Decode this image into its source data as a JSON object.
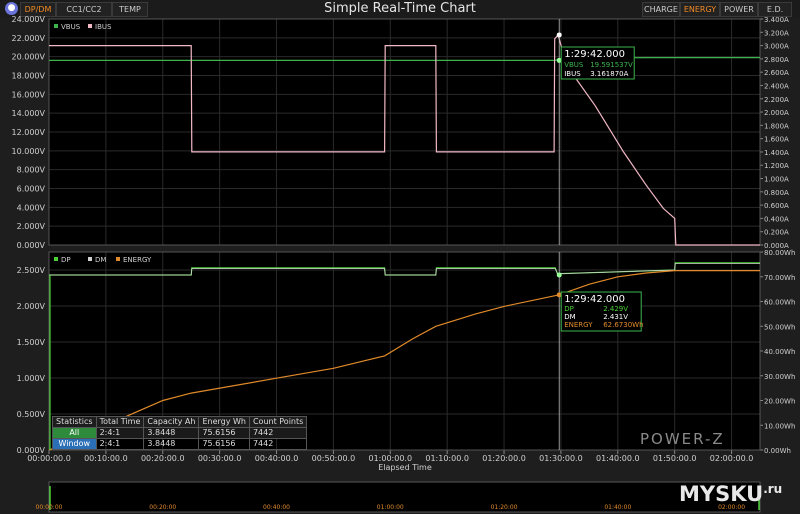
{
  "app": {
    "title": "Simple Real-Time Chart"
  },
  "left_tabs": [
    {
      "label": "DP/DM",
      "active": true
    },
    {
      "label": "CC1/CC2",
      "active": false
    },
    {
      "label": "TEMP",
      "active": false
    }
  ],
  "right_tabs": [
    {
      "label": "CHARGE",
      "active": false
    },
    {
      "label": "ENERGY",
      "active": true
    },
    {
      "label": "POWER",
      "active": false
    },
    {
      "label": "E.D.",
      "active": false
    }
  ],
  "colors": {
    "vbus": "#3cb44b",
    "ibus": "#f2b8c6",
    "dp": "#4cd137",
    "dm": "#d0d0d0",
    "energy": "#e08a2a",
    "accent": "#f08a24",
    "background": "#1e1e1e"
  },
  "chart_data": [
    {
      "type": "line",
      "legend": [
        "VBUS",
        "IBUS"
      ],
      "legend_position": "top-left",
      "x_ticks": [
        "00:00:00.0",
        "00:10:00.0",
        "00:20:00.0",
        "00:30:00.0",
        "00:40:00.0",
        "00:50:00.0",
        "01:00:00.0",
        "01:10:00.0",
        "01:20:00.0",
        "01:30:00.0",
        "01:40:00.0",
        "01:50:00.0",
        "02:00:00.0"
      ],
      "y_left_ticks": [
        "0.000V",
        "2.000V",
        "4.000V",
        "6.000V",
        "8.000V",
        "10.000V",
        "12.000V",
        "14.000V",
        "16.000V",
        "18.000V",
        "20.000V",
        "22.000V",
        "24.000V"
      ],
      "y_right_ticks": [
        "0.000A",
        "0.200A",
        "0.400A",
        "0.600A",
        "0.800A",
        "1.000A",
        "1.200A",
        "1.400A",
        "1.600A",
        "1.800A",
        "2.000A",
        "2.200A",
        "2.400A",
        "2.600A",
        "2.800A",
        "3.000A",
        "3.200A",
        "3.400A"
      ],
      "y_left_range": [
        0,
        24
      ],
      "y_right_range": [
        0,
        3.4
      ],
      "x_range_min": [
        0,
        125
      ],
      "series": [
        {
          "name": "VBUS",
          "axis": "left",
          "points": [
            [
              0,
              19.6
            ],
            [
              25,
              19.6
            ],
            [
              25.1,
              19.6
            ],
            [
              59,
              19.6
            ],
            [
              59.1,
              19.6
            ],
            [
              68,
              19.6
            ],
            [
              68.1,
              19.6
            ],
            [
              89,
              19.6
            ],
            [
              90,
              19.8
            ],
            [
              105,
              19.9
            ],
            [
              125,
              19.9
            ]
          ]
        },
        {
          "name": "IBUS",
          "axis": "right",
          "points": [
            [
              0,
              3.0
            ],
            [
              25,
              3.0
            ],
            [
              25.1,
              1.4
            ],
            [
              59,
              1.4
            ],
            [
              59.1,
              3.0
            ],
            [
              68,
              3.0
            ],
            [
              68.1,
              1.4
            ],
            [
              88.8,
              1.4
            ],
            [
              88.9,
              3.1
            ],
            [
              89.5,
              3.16
            ],
            [
              91,
              2.7
            ],
            [
              96,
              2.1
            ],
            [
              101,
              1.4
            ],
            [
              105,
              0.9
            ],
            [
              108,
              0.55
            ],
            [
              110,
              0.4
            ],
            [
              110.2,
              0.0
            ],
            [
              125,
              0.0
            ]
          ]
        }
      ],
      "cursor": {
        "time": "1:29:42.000",
        "x": 89.7,
        "readouts": [
          {
            "label": "VBUS",
            "value": "19.591537V"
          },
          {
            "label": "IBUS",
            "value": "3.161870A"
          }
        ]
      }
    },
    {
      "type": "line",
      "legend": [
        "DP",
        "DM",
        "ENERGY"
      ],
      "legend_position": "top-left",
      "x_ticks": [
        "00:00:00.0",
        "00:10:00.0",
        "00:20:00.0",
        "00:30:00.0",
        "00:40:00.0",
        "00:50:00.0",
        "01:00:00.0",
        "01:10:00.0",
        "01:20:00.0",
        "01:30:00.0",
        "01:40:00.0",
        "01:50:00.0",
        "02:00:00.0"
      ],
      "y_left_ticks": [
        "0.000V",
        "0.500V",
        "1.000V",
        "1.500V",
        "2.000V",
        "2.500V"
      ],
      "y_right_ticks": [
        "0.00Wh",
        "10.00Wh",
        "20.00Wh",
        "30.00Wh",
        "40.00Wh",
        "50.00Wh",
        "60.00Wh",
        "70.00Wh",
        "80.00Wh"
      ],
      "y_left_range": [
        0,
        2.75
      ],
      "y_right_range": [
        0,
        80
      ],
      "xlabel": "Elapsed Time",
      "series": [
        {
          "name": "DP",
          "axis": "left",
          "points": [
            [
              0,
              2.43
            ],
            [
              25,
              2.43
            ],
            [
              25.1,
              2.53
            ],
            [
              59,
              2.53
            ],
            [
              59.1,
              2.43
            ],
            [
              68,
              2.43
            ],
            [
              68.1,
              2.53
            ],
            [
              89,
              2.53
            ],
            [
              89.5,
              2.43
            ],
            [
              90,
              2.45
            ],
            [
              110,
              2.5
            ],
            [
              110.1,
              2.6
            ],
            [
              125,
              2.6
            ]
          ]
        },
        {
          "name": "DM",
          "axis": "left",
          "points": [
            [
              0,
              2.43
            ],
            [
              25,
              2.43
            ],
            [
              25.1,
              2.52
            ],
            [
              59,
              2.52
            ],
            [
              59.1,
              2.43
            ],
            [
              68,
              2.43
            ],
            [
              68.1,
              2.52
            ],
            [
              89,
              2.52
            ],
            [
              89.5,
              2.43
            ],
            [
              90,
              2.45
            ],
            [
              110,
              2.5
            ],
            [
              110.1,
              2.59
            ],
            [
              125,
              2.59
            ]
          ]
        },
        {
          "name": "ENERGY",
          "axis": "right",
          "points": [
            [
              0,
              0
            ],
            [
              5,
              4
            ],
            [
              12,
              12
            ],
            [
              20,
              20
            ],
            [
              25,
              23
            ],
            [
              40,
              29
            ],
            [
              50,
              33
            ],
            [
              59,
              38
            ],
            [
              64,
              45
            ],
            [
              68,
              50
            ],
            [
              75,
              55
            ],
            [
              80,
              58
            ],
            [
              89.7,
              62.7
            ],
            [
              95,
              67
            ],
            [
              100,
              70
            ],
            [
              105,
              71.5
            ],
            [
              110,
              72.5
            ],
            [
              125,
              72.5
            ]
          ]
        }
      ],
      "cursor": {
        "time": "1:29:42.000",
        "x": 89.7,
        "readouts": [
          {
            "label": "DP",
            "value": "2.429V"
          },
          {
            "label": "DM",
            "value": "2.431V"
          },
          {
            "label": "ENERGY",
            "value": "62.6730Wh"
          }
        ]
      }
    },
    {
      "type": "line",
      "role": "overview",
      "x_ticks": [
        "00:00:00",
        "00:20:00",
        "00:40:00",
        "01:00:00",
        "01:20:00",
        "01:40:00",
        "02:00:00"
      ]
    }
  ],
  "statistics": {
    "headers": [
      "Statistics",
      "Total Time",
      "Capacity Ah",
      "Energy Wh",
      "Count Points"
    ],
    "rows": [
      {
        "name": "All",
        "total_time": "2:4:1",
        "capacity": "3.8448",
        "energy": "75.6156",
        "count": "7442"
      },
      {
        "name": "Window",
        "total_time": "2:4:1",
        "capacity": "3.8448",
        "energy": "75.6156",
        "count": "7442"
      }
    ]
  },
  "watermarks": {
    "brand": "POWER-Z",
    "site": "MYSKU",
    "site_suffix": ".ru"
  }
}
